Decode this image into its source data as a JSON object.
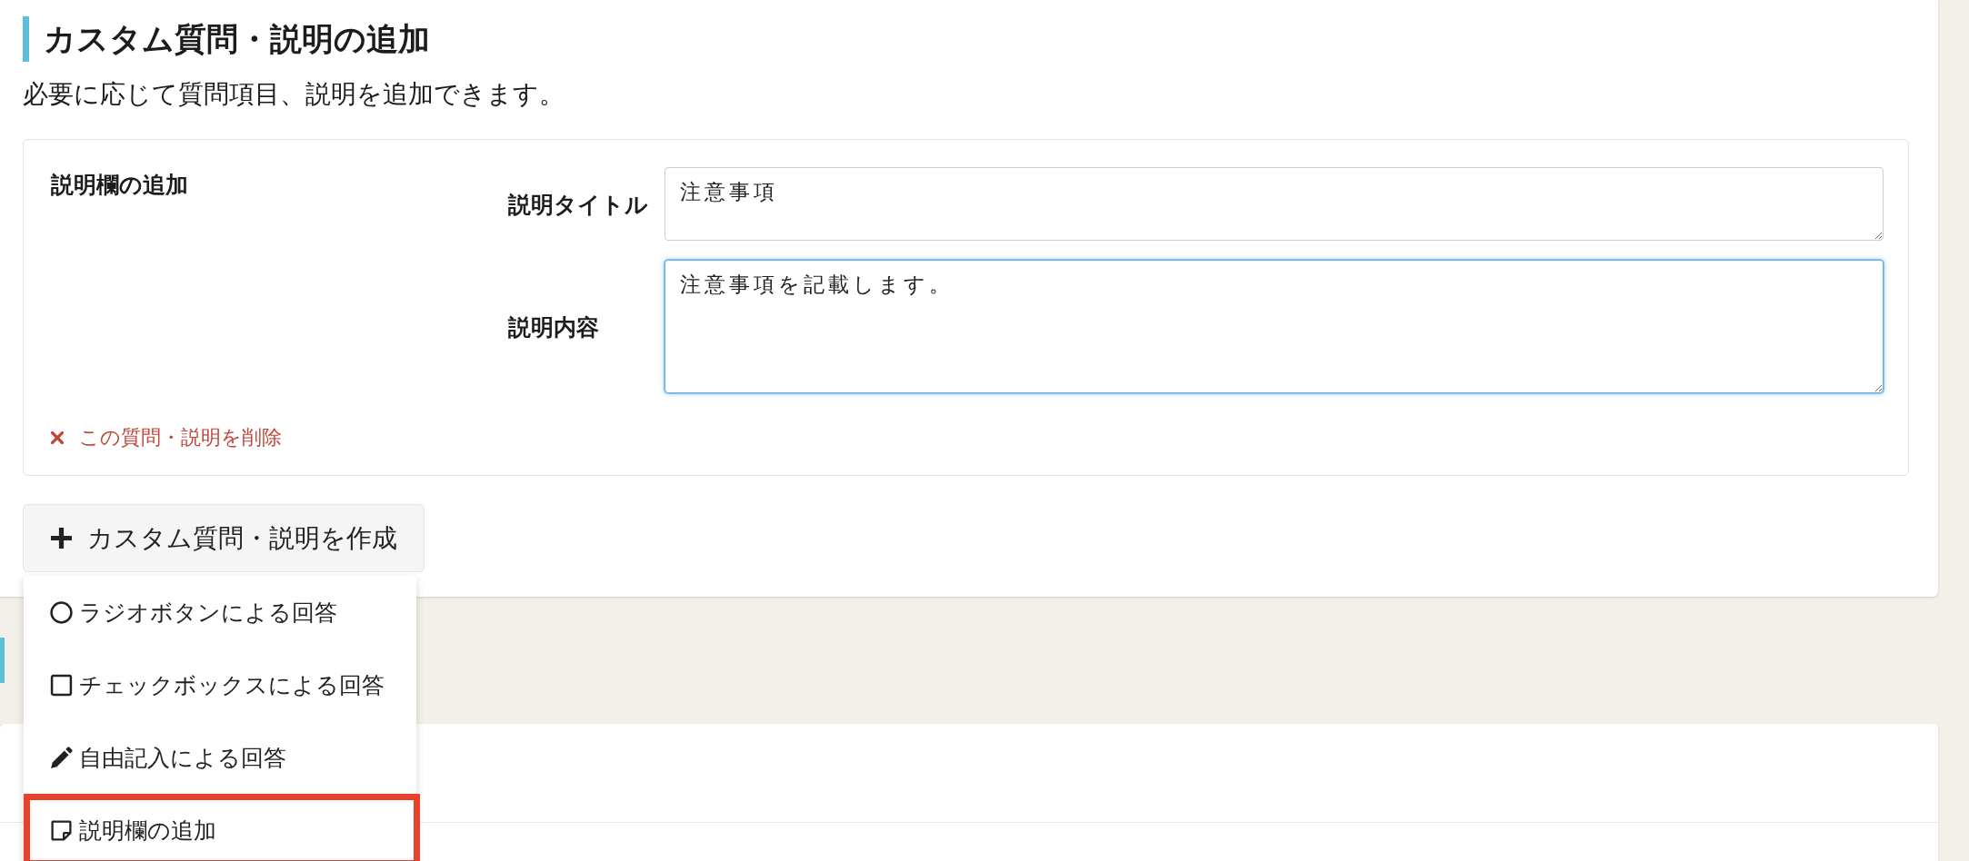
{
  "section": {
    "title": "カスタム質問・説明の追加",
    "description": "必要に応じて質問項目、説明を追加できます。"
  },
  "custom_item": {
    "type_label": "説明欄の追加",
    "fields": [
      {
        "label": "説明タイトル",
        "value": "注意事項",
        "focused": false
      },
      {
        "label": "説明内容",
        "value": "注意事項を記載します。",
        "focused": true
      }
    ],
    "delete_link": "この質問・説明を削除"
  },
  "create_button": {
    "label": "カスタム質問・説明を作成",
    "expanded": true
  },
  "dropdown": {
    "items": [
      {
        "kind": "radio",
        "label": "ラジオボタンによる回答",
        "highlighted": false
      },
      {
        "kind": "checkbox",
        "label": "チェックボックスによる回答",
        "highlighted": false
      },
      {
        "kind": "free_text",
        "label": "自由記入による回答",
        "highlighted": false
      },
      {
        "kind": "description",
        "label": "説明欄の追加",
        "highlighted": true
      }
    ]
  }
}
